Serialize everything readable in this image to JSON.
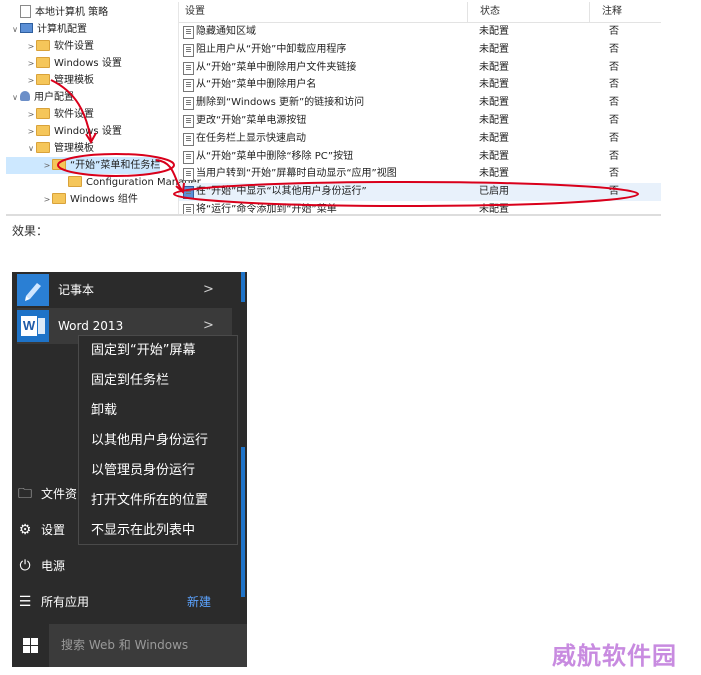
{
  "gp": {
    "tree": [
      {
        "label": "本地计算机 策略",
        "icon": "document-icon",
        "arrow": ""
      },
      {
        "label": "计算机配置",
        "icon": "computer-icon",
        "arrow": "∨"
      },
      {
        "label": "软件设置",
        "icon": "folder-icon",
        "arrow": ">"
      },
      {
        "label": "Windows 设置",
        "icon": "folder-icon",
        "arrow": ">"
      },
      {
        "label": "管理模板",
        "icon": "folder-icon",
        "arrow": ">"
      },
      {
        "label": "用户配置",
        "icon": "user-icon",
        "arrow": "∨"
      },
      {
        "label": "软件设置",
        "icon": "folder-icon",
        "arrow": ">"
      },
      {
        "label": "Windows 设置",
        "icon": "folder-icon",
        "arrow": ">"
      },
      {
        "label": "管理模板",
        "icon": "folder-icon",
        "arrow": "∨"
      },
      {
        "label": "“开始”菜单和任务栏",
        "icon": "folder-icon",
        "arrow": ">"
      },
      {
        "label": "Configuration Manager",
        "icon": "folder-icon",
        "arrow": ""
      },
      {
        "label": "Windows 组件",
        "icon": "folder-icon",
        "arrow": ">"
      }
    ],
    "columns": {
      "setting": "设置",
      "state": "状态",
      "note": "注释"
    },
    "rows": [
      {
        "name": "隐藏通知区域",
        "state": "未配置",
        "note": "否"
      },
      {
        "name": "阻止用户从“开始”中卸载应用程序",
        "state": "未配置",
        "note": "否"
      },
      {
        "name": "从“开始”菜单中删除用户文件夹链接",
        "state": "未配置",
        "note": "否"
      },
      {
        "name": "从“开始”菜单中删除用户名",
        "state": "未配置",
        "note": "否"
      },
      {
        "name": "删除到“Windows 更新”的链接和访问",
        "state": "未配置",
        "note": "否"
      },
      {
        "name": "更改“开始”菜单电源按钮",
        "state": "未配置",
        "note": "否"
      },
      {
        "name": "在任务栏上显示快速启动",
        "state": "未配置",
        "note": "否"
      },
      {
        "name": "从“开始”菜单中删除“移除 PC”按钮",
        "state": "未配置",
        "note": "否"
      },
      {
        "name": "当用户转到“开始”屏幕时自动显示“应用”视图",
        "state": "未配置",
        "note": "否"
      },
      {
        "name": "在“开始”中显示“以其他用户身份运行”",
        "state": "已启用",
        "note": "否"
      },
      {
        "name": "将“运行”命令添加到“开始”菜单",
        "state": "未配置",
        "note": ""
      }
    ],
    "annotation_color": "#d9001b"
  },
  "caption": "效果：",
  "start": {
    "apps": [
      {
        "label": "记事本",
        "icon": "notepad-icon",
        "chevron": ">"
      },
      {
        "label": "Word 2013",
        "icon": "word-icon",
        "chevron": ">",
        "badge": "W"
      }
    ],
    "side": [
      {
        "label": "文件资",
        "icon": "file-explorer-icon",
        "glyph": "🗀"
      },
      {
        "label": "设置",
        "icon": "gear-icon",
        "glyph": "⚙"
      },
      {
        "label": "电源",
        "icon": "power-icon",
        "glyph": "⏻"
      },
      {
        "label": "所有应用",
        "icon": "all-apps-icon",
        "glyph": "☰"
      }
    ],
    "new_label": "新建",
    "search_placeholder": "搜索 Web 和 Windows",
    "context_menu": [
      "固定到“开始”屏幕",
      "固定到任务栏",
      "卸载",
      "以其他用户身份运行",
      "以管理员身份运行",
      "打开文件所在的位置",
      "不显示在此列表中"
    ],
    "accent": "#1e73c8"
  },
  "watermark": "威航软件园"
}
